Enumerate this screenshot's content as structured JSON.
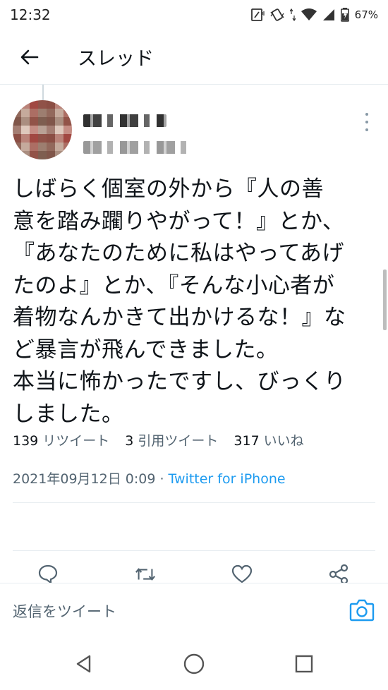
{
  "status_bar": {
    "time": "12:32",
    "battery": "67%",
    "icons": [
      "nfc-icon",
      "vibrate-icon",
      "data-arrows-icon",
      "wifi-icon",
      "signal-icon",
      "battery-charging-icon"
    ]
  },
  "header": {
    "back_icon": "arrow-left-icon",
    "title": "スレッド"
  },
  "tweet": {
    "author_name_blurred": true,
    "text": "しばらく個室の外から『人の善\n意を踏み躙りやがって！』とか、\n『あなたのために私はやってあげ\nたのよ』とか、『そんな小心者が\n着物なんかきて出かけるな！』な\nど暴言が飛んできました。\n本当に怖かったですし、びっくり\nしました。",
    "timestamp": "2021年09月12日 0:09",
    "separator": " · ",
    "source": "Twitter for iPhone",
    "stats": {
      "retweets_count": "139",
      "retweets_label": "リツイート",
      "quotes_count": "3",
      "quotes_label": "引用ツイート",
      "likes_count": "317",
      "likes_label": "いいね"
    },
    "actions": [
      "reply-icon",
      "retweet-icon",
      "like-icon",
      "share-icon"
    ]
  },
  "reply_bar": {
    "placeholder": "返信をツイート",
    "camera_icon": "camera-icon"
  },
  "nav_bar": {
    "buttons": [
      "back-triangle-icon",
      "home-circle-icon",
      "recents-square-icon"
    ]
  },
  "colors": {
    "accent": "#1d9bf0",
    "text": "#0f1419",
    "secondary": "#536471",
    "divider": "#e6ecf0"
  }
}
